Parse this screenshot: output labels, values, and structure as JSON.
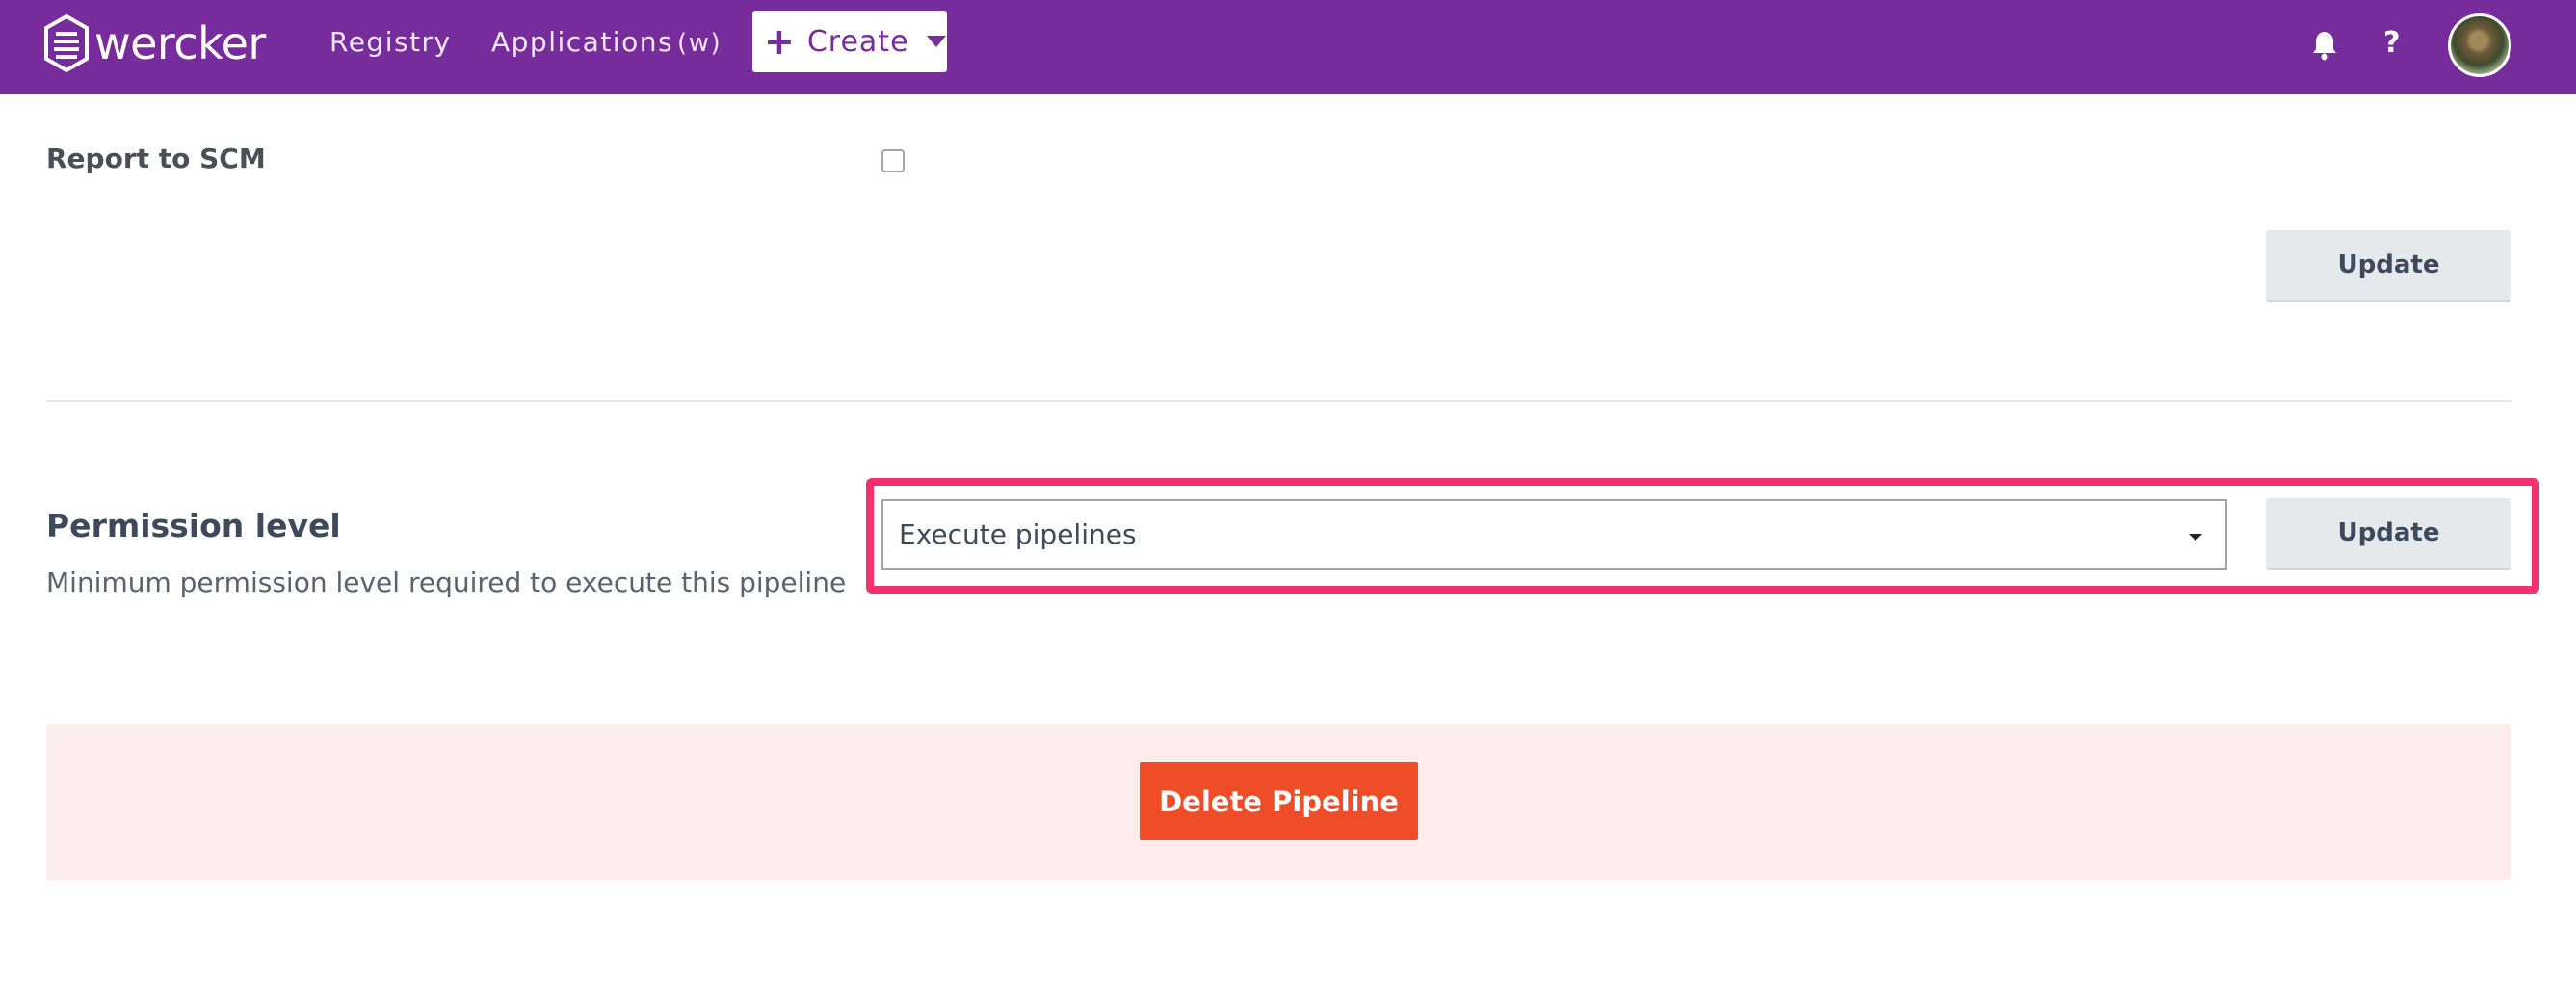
{
  "nav": {
    "logo_text": "wercker",
    "registry": "Registry",
    "applications": "Applications",
    "applications_badge": "(w)",
    "create_plus": "+",
    "create_label": "Create",
    "help": "?"
  },
  "colors": {
    "brand": "#772c9c",
    "highlight": "#f5306e",
    "danger": "#ef4c28",
    "danger_bg": "#fcecec"
  },
  "icons": {
    "logo": "wercker-logo-icon",
    "create_plus": "plus-icon",
    "create_caret": "caret-down-icon",
    "bell": "bell-icon",
    "help": "question-icon",
    "avatar": "user-avatar"
  },
  "report_scm": {
    "label": "Report to SCM",
    "checked": false,
    "update_label": "Update"
  },
  "permission": {
    "title": "Permission level",
    "description": "Minimum permission level required to execute this pipeline",
    "selected": "Execute pipelines",
    "update_label": "Update"
  },
  "danger": {
    "delete_label": "Delete Pipeline"
  }
}
